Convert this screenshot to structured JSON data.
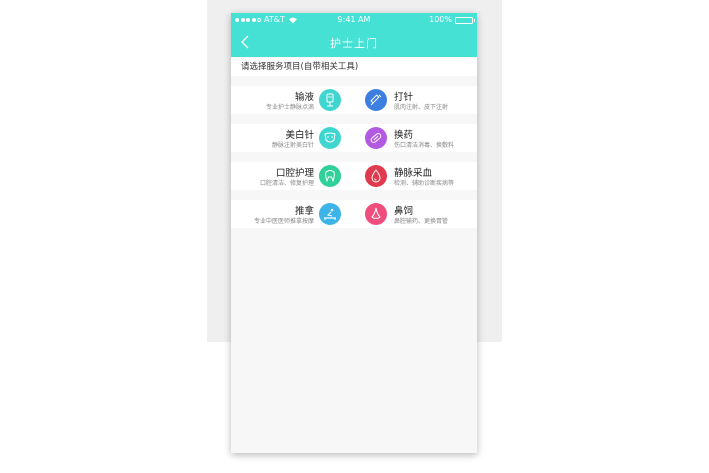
{
  "status_bar": {
    "carrier": "AT&T",
    "time": "9:41 AM",
    "battery": "100%"
  },
  "nav": {
    "title": "护士上门"
  },
  "section": {
    "label": "请选择服务项目(自带相关工具)"
  },
  "services": [
    {
      "name": "输液",
      "desc": "专业护士静脉点滴",
      "icon": "iv-drip-icon",
      "color": "#3ed6cf"
    },
    {
      "name": "打针",
      "desc": "肌肉注射、皮下注射",
      "icon": "syringe-icon",
      "color": "#3d7fe0"
    },
    {
      "name": "美白针",
      "desc": "静脉注射美白针",
      "icon": "face-mask-icon",
      "color": "#3ed6cf"
    },
    {
      "name": "换药",
      "desc": "伤口清洁消毒、换敷料",
      "icon": "pill-icon",
      "color": "#b35be0"
    },
    {
      "name": "口腔护理",
      "desc": "口腔清洁、修复护理",
      "icon": "tooth-icon",
      "color": "#2fd09a"
    },
    {
      "name": "静脉采血",
      "desc": "检测、辅助诊断疾病等",
      "icon": "blood-drop-icon",
      "color": "#e03a4e"
    },
    {
      "name": "推拿",
      "desc": "专业中医医师推拿按摩",
      "icon": "massage-icon",
      "color": "#3db4e8"
    },
    {
      "name": "鼻饲",
      "desc": "鼻腔输药、更换胃管",
      "icon": "nose-icon",
      "color": "#ef4d7b"
    }
  ]
}
